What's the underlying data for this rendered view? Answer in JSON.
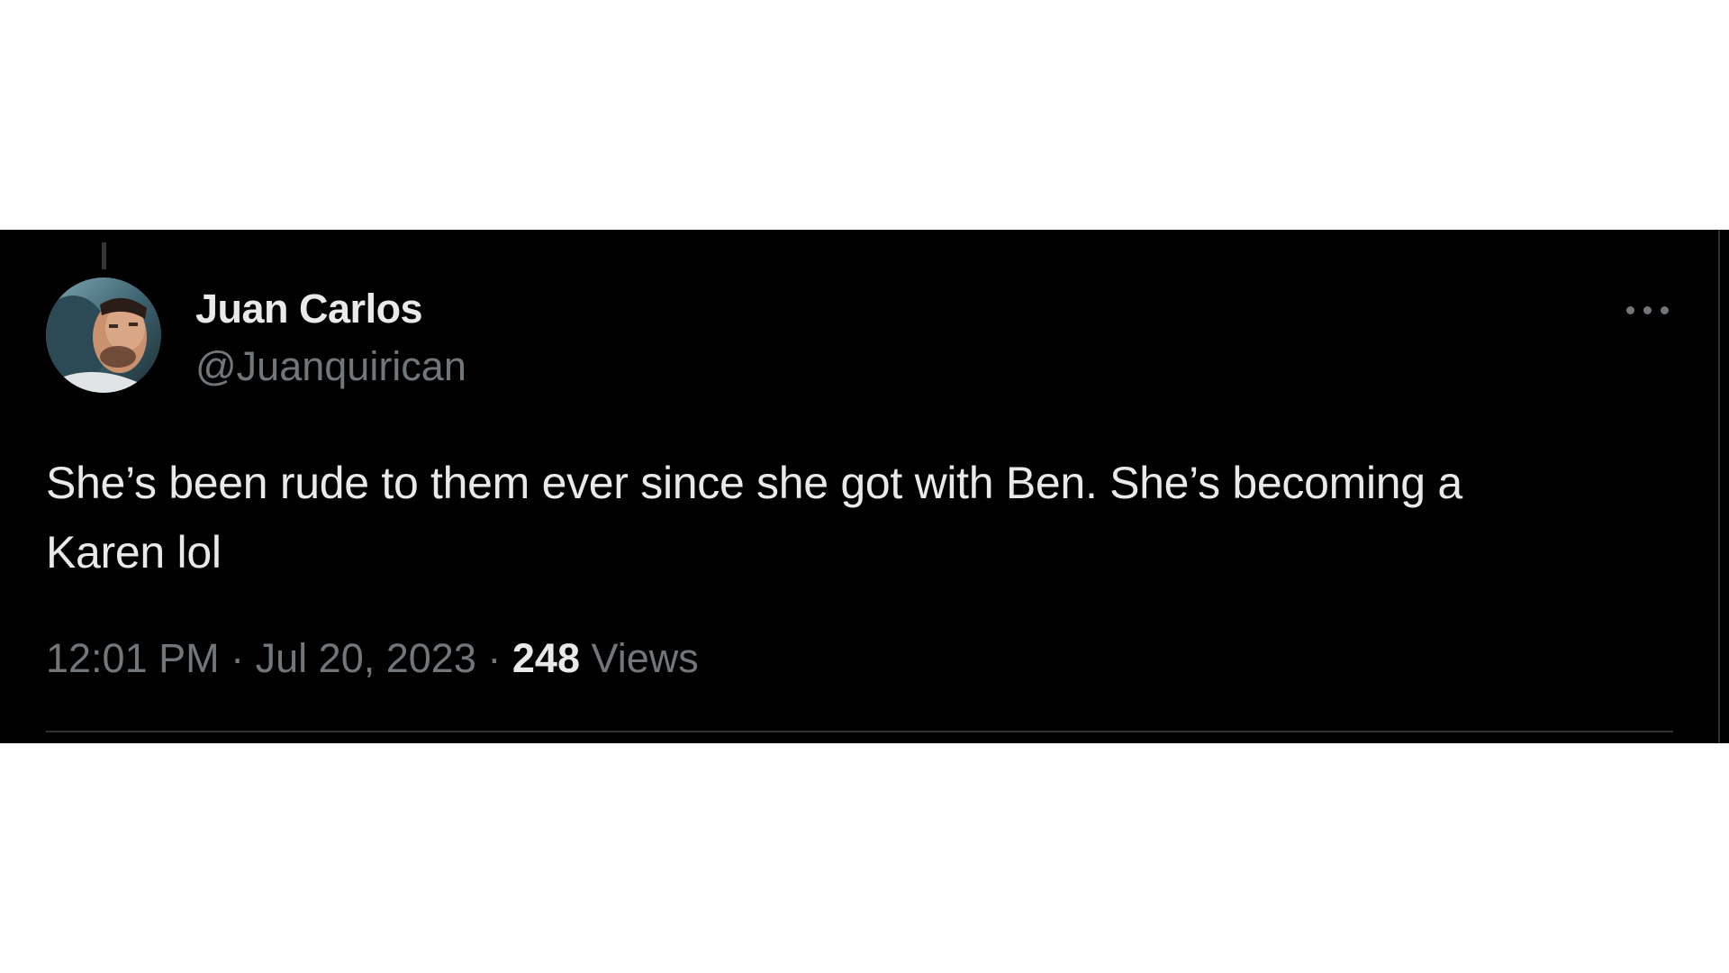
{
  "tweet": {
    "display_name": "Juan Carlos",
    "handle": "@Juanquirican",
    "text_line1": "She’s been rude to them ever since she got with Ben. She’s becoming a",
    "text_line2": "Karen lol",
    "time": "12:01 PM",
    "separator": "·",
    "date": "Jul 20, 2023",
    "views_count": "248",
    "views_label": "Views",
    "more_icon": "more-horizontal-icon",
    "avatar_icon": "profile-photo"
  },
  "colors": {
    "background": "#000000",
    "primary_text": "#e7e9ea",
    "secondary_text": "#71767b",
    "divider": "#2f3336"
  }
}
